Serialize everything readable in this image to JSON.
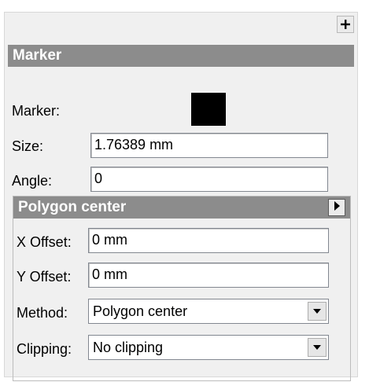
{
  "toolbar": {
    "add_icon": "plus-icon"
  },
  "marker_section": {
    "title": "Marker",
    "marker_label": "Marker:",
    "marker_color": "#000000",
    "size_label": "Size:",
    "size_value": "1.76389 mm",
    "angle_label": "Angle:",
    "angle_value": "0"
  },
  "polygon_section": {
    "title": "Polygon center",
    "expand_icon": "play-arrow-icon",
    "x_offset_label": "X Offset:",
    "x_offset_value": "0 mm",
    "y_offset_label": "Y Offset:",
    "y_offset_value": "0 mm",
    "method_label": "Method:",
    "method_value": "Polygon center",
    "clipping_label": "Clipping:",
    "clipping_value": "No clipping"
  },
  "colors": {
    "header_bg": "#8c8c8c",
    "panel_bg": "#f0f0f0"
  }
}
